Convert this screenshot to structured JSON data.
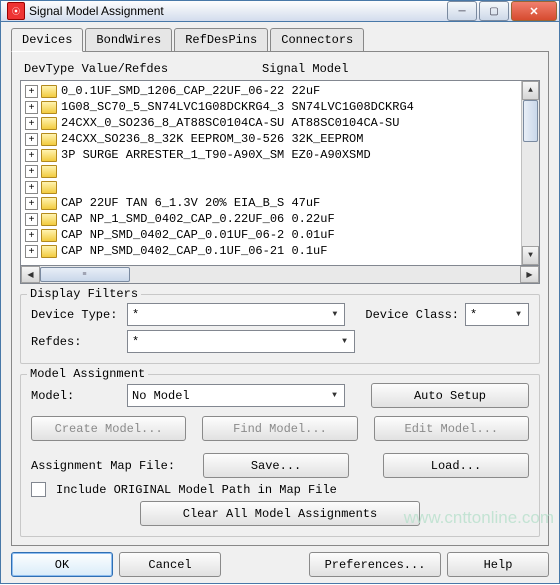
{
  "window": {
    "title": "Signal Model Assignment",
    "icon_glyph": "⦿"
  },
  "tabs": {
    "devices": "Devices",
    "bondwires": "BondWires",
    "refdespins": "RefDesPins",
    "connectors": "Connectors"
  },
  "headers": {
    "devtype": "DevType Value/Refdes",
    "sigmodel": "Signal Model"
  },
  "tree": [
    "0_0.1UF_SMD_1206_CAP_22UF_06-22 22uF",
    "1G08_SC70_5_SN74LVC1G08DCKRG4_3 SN74LVC1G08DCKRG4",
    "24CXX_0_SO236_8_AT88SC0104CA-SU AT88SC0104CA-SU",
    "24CXX_SO236_8_32K EEPROM_30-526 32K_EEPROM",
    "3P SURGE ARRESTER_1_T90-A90X_SM EZ0-A90XSMD",
    "",
    "",
    "CAP 22UF TAN 6_1.3V 20% EIA_B_S 47uF",
    "CAP NP_1_SMD_0402_CAP_0.22UF_06 0.22uF",
    "CAP NP_SMD_0402_CAP_0.01UF_06-2 0.01uF",
    "CAP NP_SMD_0402_CAP_0.1UF_06-21 0.1uF"
  ],
  "filters": {
    "title": "Display Filters",
    "device_type_label": "Device Type:",
    "device_type_value": "*",
    "device_class_label": "Device Class:",
    "device_class_value": "*",
    "refdes_label": "Refdes:",
    "refdes_value": "*"
  },
  "assignment": {
    "title": "Model Assignment",
    "model_label": "Model:",
    "model_value": "No Model",
    "auto_setup": "Auto Setup",
    "create_model": "Create Model...",
    "find_model": "Find Model...",
    "edit_model": "Edit Model...",
    "map_label": "Assignment Map File:",
    "save": "Save...",
    "load": "Load...",
    "include_original": "Include ORIGINAL Model Path in Map File",
    "clear_all": "Clear All Model Assignments"
  },
  "footer": {
    "ok": "OK",
    "cancel": "Cancel",
    "preferences": "Preferences...",
    "help": "Help"
  },
  "watermark": "www.cnttonline.com"
}
